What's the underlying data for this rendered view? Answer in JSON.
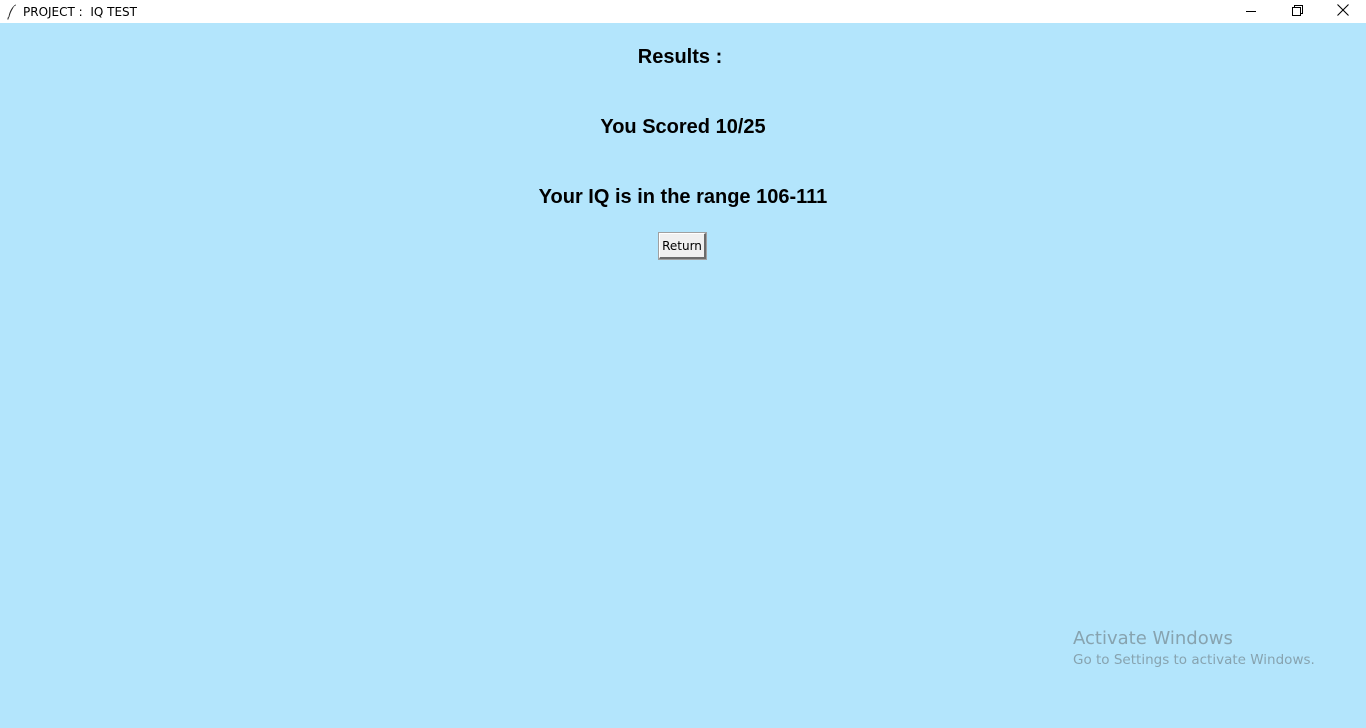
{
  "window": {
    "title": "PROJECT :  IQ TEST",
    "background_color": "#b3e5fc",
    "icon": "feather-icon",
    "controls": [
      "minimize-icon",
      "restore-icon",
      "close-icon"
    ]
  },
  "results": {
    "heading": "Results :",
    "score_text": "You Scored 10/25",
    "iq_text": "Your IQ is in the range 106-111",
    "return_label": "Return"
  },
  "watermark": {
    "title": "Activate Windows",
    "subtitle": "Go to Settings to activate Windows."
  }
}
